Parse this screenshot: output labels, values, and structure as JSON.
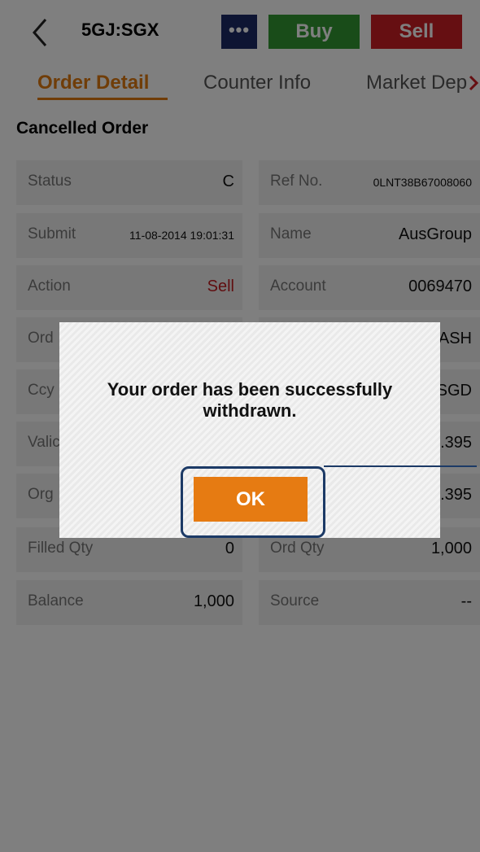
{
  "header": {
    "symbol": "5GJ:SGX",
    "more_label": "•••",
    "buy_label": "Buy",
    "sell_label": "Sell"
  },
  "tabs": [
    {
      "label": "Order Detail",
      "active": true
    },
    {
      "label": "Counter Info",
      "active": false
    },
    {
      "label": "Market Dep",
      "active": false
    }
  ],
  "section_title": "Cancelled Order",
  "fields": {
    "status": {
      "label": "Status",
      "value": "C"
    },
    "ref_no": {
      "label": "Ref No.",
      "value": "0LNT38B67008060"
    },
    "submit": {
      "label": "Submit",
      "value": "11-08-2014 19:01:31"
    },
    "name": {
      "label": "Name",
      "value": "AusGroup"
    },
    "action": {
      "label": "Action",
      "value": "Sell"
    },
    "account": {
      "label": "Account",
      "value": "0069470"
    },
    "ord": {
      "label": "Ord",
      "value": "ASH"
    },
    "ccy": {
      "label": "Ccy",
      "value": "SGD"
    },
    "valid": {
      "label": "Valic",
      "value": ".395"
    },
    "org": {
      "label": "Org",
      "value": ".395"
    },
    "filled_qty": {
      "label": "Filled Qty",
      "value": "0"
    },
    "ord_qty": {
      "label": "Ord Qty",
      "value": "1,000"
    },
    "balance": {
      "label": "Balance",
      "value": "1,000"
    },
    "source": {
      "label": "Source",
      "value": "--"
    }
  },
  "dialog": {
    "message": "Your order has been successfully withdrawn.",
    "ok_label": "OK"
  },
  "colors": {
    "accent": "#e07a10",
    "buy": "#339933",
    "sell": "#cc1f25",
    "more": "#1c2b66",
    "highlight_frame": "#1c3a66"
  }
}
